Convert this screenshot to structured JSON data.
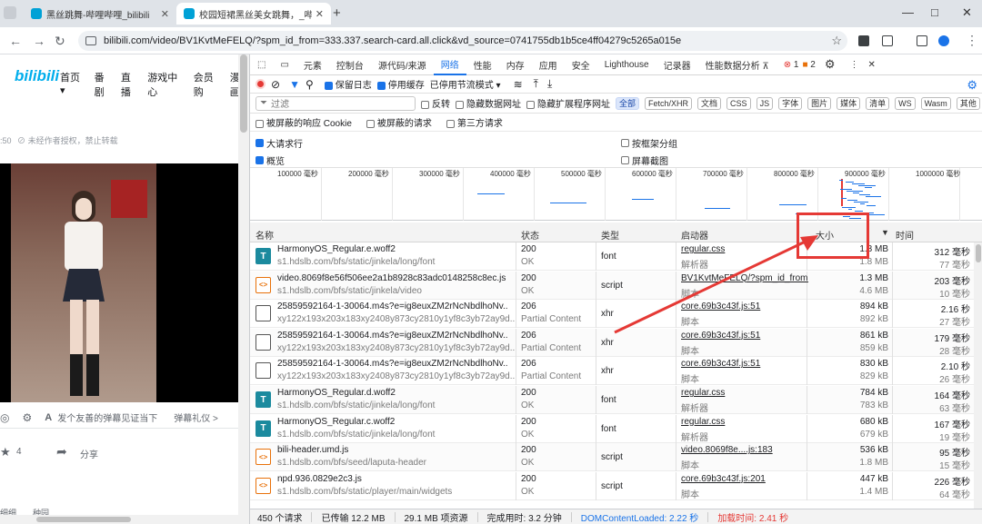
{
  "browser": {
    "tabs": [
      {
        "title": "黑丝跳舞-哔哩哔哩_bilibili",
        "active": false
      },
      {
        "title": "校园短裙黑丝美女跳舞，_哔哩",
        "active": true
      }
    ],
    "new_tab": "+",
    "window_controls": {
      "minimize": "—",
      "maximize": "□",
      "close": "✕"
    },
    "url": "bilibili.com/video/BV1KvtMeFELQ/?spm_id_from=333.337.search-card.all.click&vd_source=0741755db1b5ce4ff04279c5265a015e"
  },
  "page": {
    "logo": "bilibili",
    "nav": [
      "首页",
      "番剧",
      "直播",
      "游戏中心",
      "会员购",
      "漫画"
    ],
    "nav_dropdown": "▾",
    "meta_time": ":50",
    "meta_notice": "未经作者授权，禁止转载",
    "danmu_placeholder": "发个友善的弹幕见证当下",
    "danmu_etiquette": "弹幕礼仪 >",
    "like_count": "4",
    "share_label": "分享",
    "tags": [
      "细细",
      "种园"
    ]
  },
  "devtools": {
    "panel_tabs": [
      "元素",
      "控制台",
      "源代码/来源",
      "网络",
      "性能",
      "内存",
      "应用",
      "安全",
      "Lighthouse",
      "记录器",
      "性能数据分析 ⊼"
    ],
    "active_panel": "网络",
    "errors": "1",
    "warnings": "2",
    "toolbar": {
      "preserve_log": "保留日志",
      "disable_cache": "停用缓存",
      "throttling": "已停用节流模式"
    },
    "filter": {
      "placeholder": "过滤",
      "invert": "反转",
      "hide_data_urls": "隐藏数据网址",
      "hide_extension_urls": "隐藏扩展程序网址",
      "types": [
        "全部",
        "Fetch/XHR",
        "文档",
        "CSS",
        "JS",
        "字体",
        "图片",
        "媒体",
        "清单",
        "WS",
        "Wasm",
        "其他"
      ],
      "active_type": "全部"
    },
    "blocked_row": {
      "blocked_cookies": "被屏蔽的响应 Cookie",
      "blocked_requests": "被屏蔽的请求",
      "third_party": "第三方请求"
    },
    "settings": {
      "big_rows": "大请求行",
      "group_by_frame": "按框架分组",
      "overview": "概览",
      "screenshots": "屏幕截图"
    },
    "timeline_ticks": [
      "100000 毫秒",
      "200000 毫秒",
      "300000 毫秒",
      "400000 毫秒",
      "500000 毫秒",
      "600000 毫秒",
      "700000 毫秒",
      "800000 毫秒",
      "900000 毫秒",
      "1000000 毫秒"
    ],
    "columns": {
      "name": "名称",
      "status": "状态",
      "type": "类型",
      "initiator": "启动器",
      "size": "大小",
      "sort_indicator": "▼",
      "time": "时间"
    },
    "rows": [
      {
        "name": "HarmonyOS_Regular.e.woff2",
        "url": "s1.hdslb.com/bfs/static/jinkela/long/font",
        "status": "200",
        "status_text": "OK",
        "type": "font",
        "icon": "font-file-icon",
        "initiator": "regular.css",
        "initiator_sub": "解析器",
        "size": "1.8 MB",
        "size_sub": "1.8 MB",
        "time": "312 毫秒",
        "time_sub": "77 毫秒"
      },
      {
        "name": "video.8069f8e56f506ee2a1b8928c83adc0148258c8ec.js",
        "url": "s1.hdslb.com/bfs/static/jinkela/video",
        "status": "200",
        "status_text": "OK",
        "type": "script",
        "icon": "script-file-icon",
        "initiator": "BV1KvtMeFELQ/?spm_id_from=3",
        "initiator_sub": "脚本",
        "size": "1.3 MB",
        "size_sub": "4.6 MB",
        "time": "203 毫秒",
        "time_sub": "10 毫秒"
      },
      {
        "name": "25859592164-1-30064.m4s?e=ig8euxZM2rNcNbdlhoNv...",
        "url": "xy122x193x203x183xy2408y873cy2810y1yf8c3yb72ay9d...",
        "status": "206",
        "status_text": "Partial Content",
        "type": "xhr",
        "icon": "document-file-icon",
        "initiator": "core.69b3c43f.js:51",
        "initiator_sub": "脚本",
        "size": "894 kB",
        "size_sub": "892 kB",
        "time": "2.16 秒",
        "time_sub": "27 毫秒"
      },
      {
        "name": "25859592164-1-30064.m4s?e=ig8euxZM2rNcNbdlhoNv...",
        "url": "xy122x193x203x183xy2408y873cy2810y1yf8c3yb72ay9d...",
        "status": "206",
        "status_text": "Partial Content",
        "type": "xhr",
        "icon": "document-file-icon",
        "initiator": "core.69b3c43f.js:51",
        "initiator_sub": "脚本",
        "size": "861 kB",
        "size_sub": "859 kB",
        "time": "179 毫秒",
        "time_sub": "28 毫秒"
      },
      {
        "name": "25859592164-1-30064.m4s?e=ig8euxZM2rNcNbdlhoNv...",
        "url": "xy122x193x203x183xy2408y873cy2810y1yf8c3yb72ay9d...",
        "status": "206",
        "status_text": "Partial Content",
        "type": "xhr",
        "icon": "document-file-icon",
        "initiator": "core.69b3c43f.js:51",
        "initiator_sub": "脚本",
        "size": "830 kB",
        "size_sub": "829 kB",
        "time": "2.10 秒",
        "time_sub": "26 毫秒"
      },
      {
        "name": "HarmonyOS_Regular.d.woff2",
        "url": "s1.hdslb.com/bfs/static/jinkela/long/font",
        "status": "200",
        "status_text": "OK",
        "type": "font",
        "icon": "font-file-icon",
        "initiator": "regular.css",
        "initiator_sub": "解析器",
        "size": "784 kB",
        "size_sub": "783 kB",
        "time": "164 毫秒",
        "time_sub": "63 毫秒"
      },
      {
        "name": "HarmonyOS_Regular.c.woff2",
        "url": "s1.hdslb.com/bfs/static/jinkela/long/font",
        "status": "200",
        "status_text": "OK",
        "type": "font",
        "icon": "font-file-icon",
        "initiator": "regular.css",
        "initiator_sub": "解析器",
        "size": "680 kB",
        "size_sub": "679 kB",
        "time": "167 毫秒",
        "time_sub": "19 毫秒"
      },
      {
        "name": "bili-header.umd.js",
        "url": "s1.hdslb.com/bfs/seed/laputa-header",
        "status": "200",
        "status_text": "OK",
        "type": "script",
        "icon": "script-file-icon",
        "initiator": "video.8069f8e....js:183",
        "initiator_sub": "脚本",
        "size": "536 kB",
        "size_sub": "1.8 MB",
        "time": "95 毫秒",
        "time_sub": "15 毫秒"
      },
      {
        "name": "npd.936.0829e2c3.js",
        "url": "s1.hdslb.com/bfs/static/player/main/widgets",
        "status": "200",
        "status_text": "OK",
        "type": "script",
        "icon": "script-file-icon",
        "initiator": "core.69b3c43f.js:201",
        "initiator_sub": "脚本",
        "size": "447 kB",
        "size_sub": "1.4 MB",
        "time": "226 毫秒",
        "time_sub": "64 毫秒"
      }
    ],
    "status_bar": {
      "requests": "450 个请求",
      "transferred": "已传输 12.2 MB",
      "resources": "29.1 MB 项资源",
      "finish": "完成用时: 3.2 分钟",
      "dcl": "DOMContentLoaded: 2.22 秒",
      "load": "加载时间: 2.41 秒"
    }
  },
  "annotation": {
    "color": "#e53935"
  }
}
